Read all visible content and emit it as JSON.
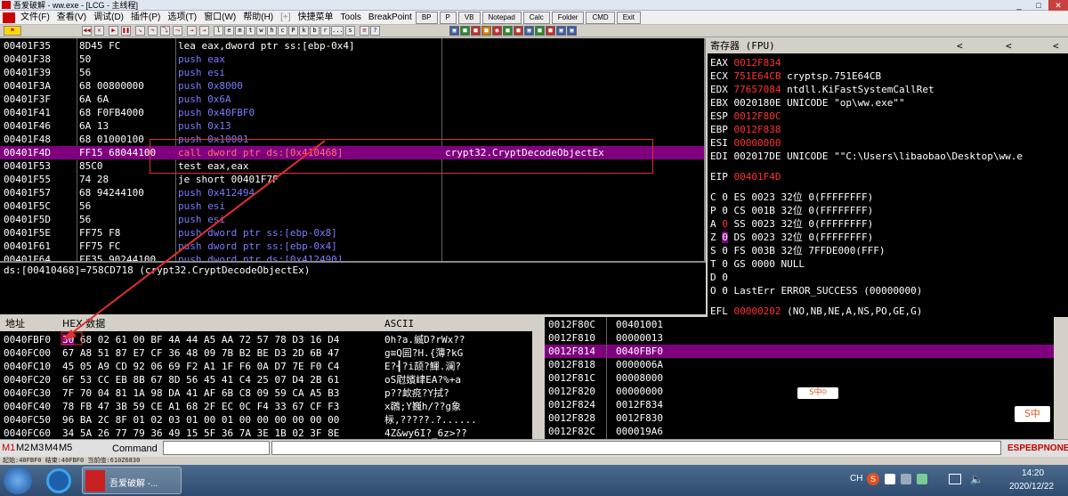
{
  "window": {
    "title": "吾爱破解 - ww.exe - [LCG - 主线程]"
  },
  "menu": {
    "items": [
      "文件(F)",
      "查看(V)",
      "调试(D)",
      "插件(P)",
      "选项(T)",
      "窗口(W)",
      "帮助(H)",
      "[+]",
      "快捷菜单",
      "Tools",
      "BreakPoint"
    ],
    "plugin_buttons": [
      "BP",
      "P",
      "VB",
      "Notepad",
      "Calc",
      "Folder",
      "CMD",
      "Exit"
    ]
  },
  "toolbar": {
    "letters": [
      "l",
      "e",
      "m",
      "t",
      "w",
      "h",
      "c",
      "P",
      "k",
      "b",
      "r",
      "...",
      "s"
    ]
  },
  "disasm": [
    {
      "addr": "00401F35",
      "hex": "8D45 FC",
      "asm": "lea eax,dword ptr ss:[ebp-0x4]",
      "kind": "normal",
      "comment": ""
    },
    {
      "addr": "00401F38",
      "hex": "50",
      "asm": "push eax",
      "kind": "push",
      "comment": ""
    },
    {
      "addr": "00401F39",
      "hex": "56",
      "asm": "push esi",
      "kind": "push",
      "comment": ""
    },
    {
      "addr": "00401F3A",
      "hex": "68 00800000",
      "asm": "push 0x8000",
      "kind": "push",
      "comment": ""
    },
    {
      "addr": "00401F3F",
      "hex": "6A 6A",
      "asm": "push 0x6A",
      "kind": "push",
      "comment": ""
    },
    {
      "addr": "00401F41",
      "hex": "68 F0FB4000",
      "asm": "push 0x40FBF0",
      "kind": "push",
      "comment": ""
    },
    {
      "addr": "00401F46",
      "hex": "6A 13",
      "asm": "push 0x13",
      "kind": "push",
      "comment": ""
    },
    {
      "addr": "00401F48",
      "hex": "68 01000100",
      "asm": "push 0x10001",
      "kind": "push",
      "comment": ""
    },
    {
      "addr": "00401F4D",
      "hex": "FF15 68044100",
      "asm": "call dword ptr ds:[0x410468]",
      "kind": "call",
      "comment": "crypt32.CryptDecodeObjectEx"
    },
    {
      "addr": "00401F53",
      "hex": "85C0",
      "asm": "test eax,eax",
      "kind": "normal",
      "comment": ""
    },
    {
      "addr": "00401F55",
      "hex": "74 28",
      "asm": "je short 00401F7F",
      "kind": "jump",
      "comment": ""
    },
    {
      "addr": "00401F57",
      "hex": "68 94244100",
      "asm": "push 0x412494",
      "kind": "push",
      "comment": ""
    },
    {
      "addr": "00401F5C",
      "hex": "56",
      "asm": "push esi",
      "kind": "push",
      "comment": ""
    },
    {
      "addr": "00401F5D",
      "hex": "56",
      "asm": "push esi",
      "kind": "push",
      "comment": ""
    },
    {
      "addr": "00401F5E",
      "hex": "FF75 F8",
      "asm": "push dword ptr ss:[ebp-0x8]",
      "kind": "push",
      "comment": ""
    },
    {
      "addr": "00401F61",
      "hex": "FF75 FC",
      "asm": "push dword ptr ss:[ebp-0x4]",
      "kind": "push",
      "comment": ""
    },
    {
      "addr": "00401F64",
      "hex": "FF35 90244100",
      "asm": "push dword ptr ds:[0x412490]",
      "kind": "push",
      "comment": ""
    }
  ],
  "info_line": "ds:[00410468]=758CD718 (crypt32.CryptDecodeObjectEx)",
  "registers": {
    "header": "寄存器 (FPU)",
    "lines": [
      {
        "name": "EAX",
        "val": "0012F834",
        "desc": "",
        "red": true
      },
      {
        "name": "ECX",
        "val": "751E64CB",
        "desc": "cryptsp.751E64CB",
        "red": true
      },
      {
        "name": "EDX",
        "val": "77657084",
        "desc": "ntdll.KiFastSystemCallRet",
        "red": true
      },
      {
        "name": "EBX",
        "val": "0020180E",
        "desc": "UNICODE \"op\\ww.exe\"\"",
        "red": false
      },
      {
        "name": "ESP",
        "val": "0012F80C",
        "desc": "",
        "red": true
      },
      {
        "name": "EBP",
        "val": "0012F838",
        "desc": "",
        "red": true
      },
      {
        "name": "ESI",
        "val": "00000000",
        "desc": "",
        "red": true
      },
      {
        "name": "EDI",
        "val": "002017DE",
        "desc": "UNICODE \"\"C:\\Users\\libaobao\\Desktop\\ww.e",
        "red": false
      }
    ],
    "eip": {
      "name": "EIP",
      "val": "00401F4D"
    },
    "flags": [
      {
        "f": "C",
        "v": "0",
        "seg": "ES 0023",
        "bits": "32位",
        "base": "0(FFFFFFFF)"
      },
      {
        "f": "P",
        "v": "0",
        "seg": "CS 001B",
        "bits": "32位",
        "base": "0(FFFFFFFF)"
      },
      {
        "f": "A",
        "v": "0",
        "seg": "SS 0023",
        "bits": "32位",
        "base": "0(FFFFFFFF)"
      },
      {
        "f": "Z",
        "v": "0",
        "seg": "DS 0023",
        "bits": "32位",
        "base": "0(FFFFFFFF)"
      },
      {
        "f": "S",
        "v": "0",
        "seg": "FS 003B",
        "bits": "32位",
        "base": "7FFDE000(FFF)"
      },
      {
        "f": "T",
        "v": "0",
        "seg": "GS 0000",
        "bits": "",
        "base": "NULL"
      },
      {
        "f": "D",
        "v": "0",
        "seg": "",
        "bits": "",
        "base": ""
      },
      {
        "f": "O",
        "v": "0",
        "seg": "LastErr",
        "bits": "",
        "base": "ERROR_SUCCESS (00000000)"
      }
    ],
    "efl": {
      "name": "EFL",
      "val": "00000202",
      "desc": "(NO,NB,NE,A,NS,PO,GE,G)"
    }
  },
  "dump": {
    "col_addr": "地址",
    "col_hex": "HEX 数据",
    "col_ascii": "ASCII",
    "rows": [
      {
        "addr": "0040FBF0",
        "hex": "30 68 02 61 00 BF 4A 44 A5 AA 72 57 78 D3 16 D4",
        "ascii": "0h?a.縅D?rWx??"
      },
      {
        "addr": "0040FC00",
        "hex": "67 A8 51 87 E7 CF 36 48 09 7B B2 BE D3 2D 6B 47",
        "ascii": "g≡Q囩?H.{薄?kG"
      },
      {
        "addr": "0040FC10",
        "hex": "45 05 A9 CD 92 06 69 F2 A1 1F F6 0A D7 7E F0 C4",
        "ascii": "E?┨?i颉?鯶.澜?"
      },
      {
        "addr": "0040FC20",
        "hex": "6F 53 CC EB 8B 67 8D 56 45 41 C4 25 07 D4 2B 61",
        "ascii": "oS屗嬪峍EA?%+a"
      },
      {
        "addr": "0040FC30",
        "hex": "7F 70 04 81 1A 98 DA 41 AF 6B C8 09 59 CA A5 B3",
        "ascii": "p??欰痥?Y拭?"
      },
      {
        "addr": "0040FC40",
        "hex": "78 FB 47 3B 59 CE A1 68 2F EC 0C F4 33 67 CF F3",
        "ascii": "x鸊;Y巍h/??g象"
      },
      {
        "addr": "0040FC50",
        "hex": "96 BA 2C 8F 01 02 03 01 00 01 00 00 00 00 00 00",
        "ascii": "柡,?????.?......"
      },
      {
        "addr": "0040FC60",
        "hex": "34 5A 26 77 79 36 49 15 5F 36 7A 3E 1B 02 3F 8E",
        "ascii": "4Z&wy6I?_6z>??"
      }
    ]
  },
  "stack": [
    {
      "addr": "0012F80C",
      "val": "00401001"
    },
    {
      "addr": "0012F810",
      "val": "00000013"
    },
    {
      "addr": "0012F814",
      "val": "0040FBF0"
    },
    {
      "addr": "0012F818",
      "val": "0000006A"
    },
    {
      "addr": "0012F81C",
      "val": "00008000"
    },
    {
      "addr": "0012F820",
      "val": "00000000"
    },
    {
      "addr": "0012F824",
      "val": "0012F834"
    },
    {
      "addr": "0012F828",
      "val": "0012F830"
    },
    {
      "addr": "0012F82C",
      "val": "000019A6"
    }
  ],
  "cmdbar": {
    "tabs": [
      "M1",
      "M2",
      "M3",
      "M4",
      "M5"
    ],
    "label": "Command",
    "regs_label": "ESPEBPNONE"
  },
  "status": {
    "text": "起始:40FBF0 结束:40FBF0 当前值:610Z6830"
  },
  "taskbar": {
    "app": "吾爱破解 -...",
    "ime": "CH",
    "time": "14:20",
    "date": "2020/12/22"
  },
  "colors": {
    "selection": "#800080",
    "push": "#7b7bff",
    "red": "#ff3030",
    "background": "#000000"
  }
}
